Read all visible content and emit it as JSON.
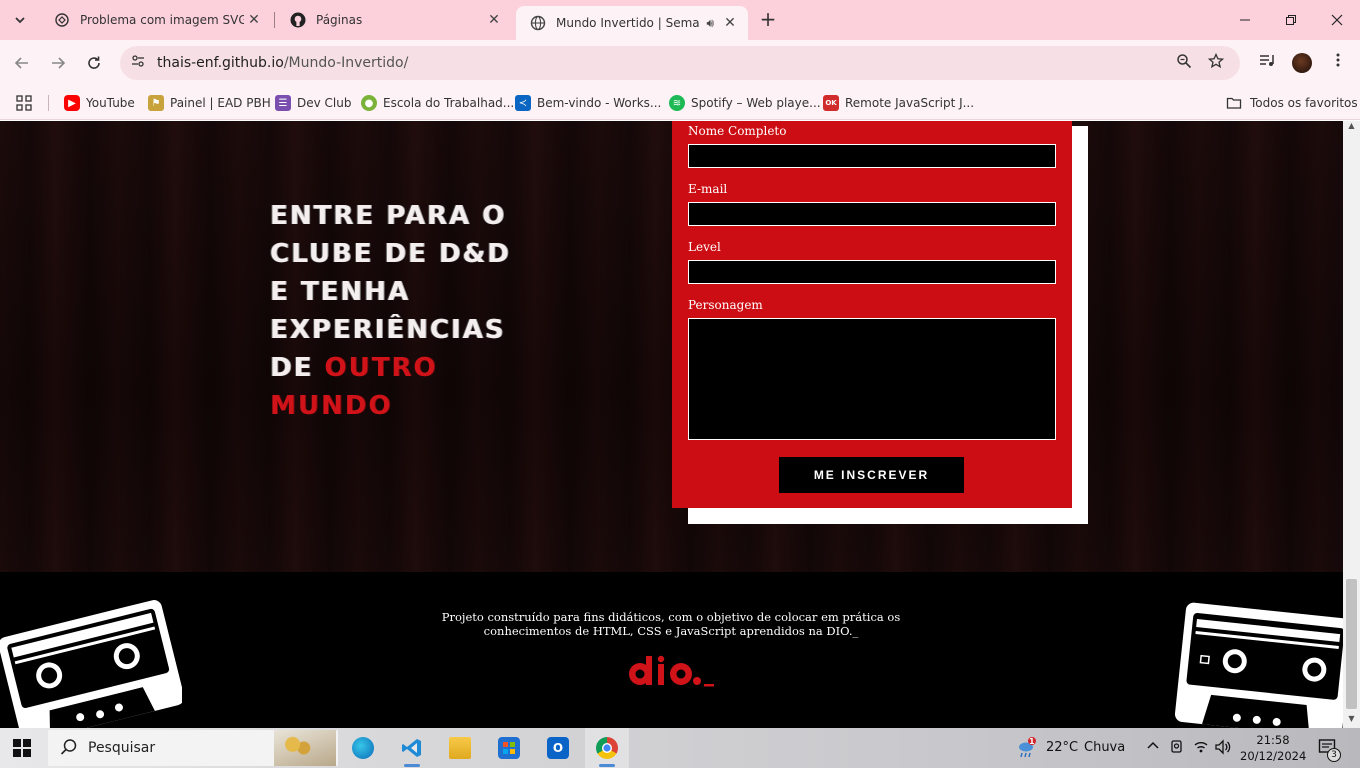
{
  "browser": {
    "tabs": [
      {
        "title": "Problema com imagem SVG",
        "icon": "chatgpt-icon",
        "active": false
      },
      {
        "title": "Páginas",
        "icon": "github-icon",
        "active": false
      },
      {
        "title": "Mundo Invertido | Semana I",
        "icon": "globe-icon",
        "active": true
      }
    ],
    "address": {
      "host": "thais-enf.github.io",
      "path": "/Mundo-Invertido/"
    },
    "bookmarks": [
      {
        "label": "YouTube",
        "color": "#ff0000",
        "glyph": "▶"
      },
      {
        "label": "Painel | EAD PBH",
        "color": "#c8a23a",
        "glyph": "⚑"
      },
      {
        "label": "Dev Club",
        "color": "#7b4fb0",
        "glyph": "☰"
      },
      {
        "label": "Escola do Trabalhad...",
        "color": "#7ab23a",
        "glyph": "●"
      },
      {
        "label": "Bem-vindo - Works...",
        "color": "#0a66c2",
        "glyph": "≺"
      },
      {
        "label": "Spotify – Web playe...",
        "color": "#1db954",
        "glyph": "≋"
      },
      {
        "label": "Remote JavaScript J...",
        "color": "#d02c2c",
        "glyph": "OK"
      }
    ],
    "all_bookmarks": "Todos os favoritos"
  },
  "hero": {
    "headline_lines": [
      "Entre para o",
      "clube de D&D",
      "e tenha",
      "experiências",
      "de "
    ],
    "headline_accent_inline": "outro",
    "headline_accent_line": "mundo",
    "accent_color": "#d01319"
  },
  "form": {
    "name_label": "Nome Completo",
    "email_label": "E-mail",
    "level_label": "Level",
    "character_label": "Personagem",
    "submit_label": "Me inscrever",
    "panel_color": "#cc0d13"
  },
  "footer": {
    "line1": "Projeto construído para fins didáticos, com o objetivo de colocar em prática os",
    "line2": "conhecimentos de HTML, CSS e JavaScript aprendidos na DIO._",
    "logo_text": "dio._"
  },
  "taskbar": {
    "search_placeholder": "Pesquisar",
    "weather_temp": "22°C",
    "weather_desc": "Chuva",
    "weather_alert_count": "1",
    "time": "21:58",
    "date": "20/12/2024",
    "notification_count": "3"
  }
}
